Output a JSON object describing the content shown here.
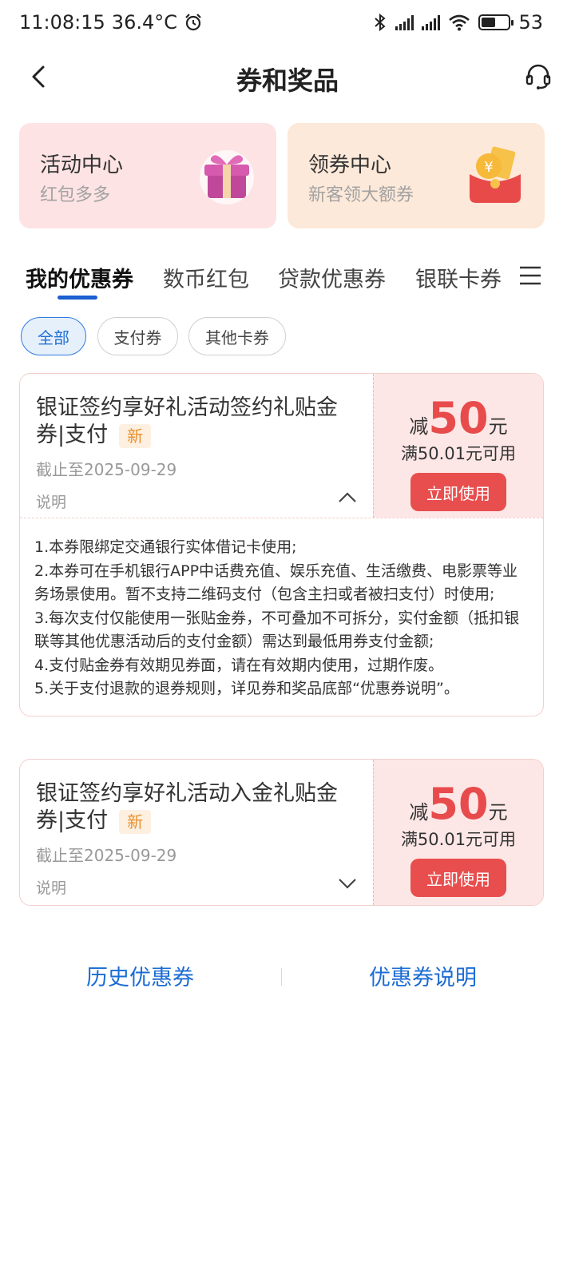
{
  "status_bar": {
    "time": "11:08:15",
    "temperature": "36.4°C",
    "battery": "53",
    "battery_level": 0.53
  },
  "header": {
    "title": "券和奖品"
  },
  "promos": [
    {
      "title": "活动中心",
      "subtitle": "红包多多",
      "icon": "gift-box-icon",
      "bg": "#fde3e4"
    },
    {
      "title": "领券中心",
      "subtitle": "新客领大额券",
      "icon": "red-envelope-coin-icon",
      "bg": "#fde9d9"
    }
  ],
  "tabs": [
    {
      "label": "我的优惠券",
      "active": true
    },
    {
      "label": "数币红包",
      "active": false
    },
    {
      "label": "贷款优惠券",
      "active": false
    },
    {
      "label": "银联卡券",
      "active": false
    }
  ],
  "filters": [
    {
      "label": "全部",
      "active": true
    },
    {
      "label": "支付券",
      "active": false
    },
    {
      "label": "其他卡券",
      "active": false
    }
  ],
  "coupons": [
    {
      "name": "银证签约享好礼活动签约礼贴金券|支付",
      "badge": "新",
      "deadline": "截止至2025-09-29",
      "desc_label": "说明",
      "amount_prefix": "减",
      "amount": "50",
      "amount_unit": "元",
      "condition": "满50.01元可用",
      "action": "立即使用",
      "expanded": true,
      "details": [
        "1.本券限绑定交通银行实体借记卡使用;",
        "2.本券可在手机银行APP中话费充值、娱乐充值、生活缴费、电影票等业务场景使用。暂不支持二维码支付（包含主扫或者被扫支付）时使用;",
        "3.每次支付仅能使用一张贴金券，不可叠加不可拆分，实付金额（抵扣银联等其他优惠活动后的支付金额）需达到最低用券支付金额;",
        "4.支付贴金券有效期见券面，请在有效期内使用，过期作废。",
        "5.关于支付退款的退券规则，详见券和奖品底部“优惠券说明”。"
      ]
    },
    {
      "name": "银证签约享好礼活动入金礼贴金券|支付",
      "badge": "新",
      "deadline": "截止至2025-09-29",
      "desc_label": "说明",
      "amount_prefix": "减",
      "amount": "50",
      "amount_unit": "元",
      "condition": "满50.01元可用",
      "action": "立即使用",
      "expanded": false
    }
  ],
  "bottom_links": {
    "history": "历史优惠券",
    "explanation": "优惠券说明"
  },
  "colors": {
    "accent_blue": "#1b6cd4",
    "coupon_red": "#e84b4b"
  }
}
